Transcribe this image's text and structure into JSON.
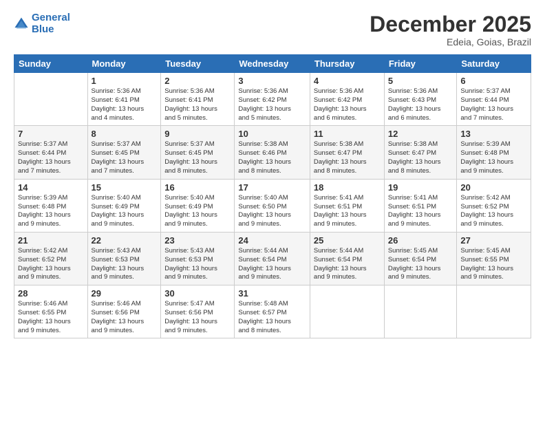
{
  "logo": {
    "line1": "General",
    "line2": "Blue"
  },
  "title": "December 2025",
  "subtitle": "Edeia, Goias, Brazil",
  "days_of_week": [
    "Sunday",
    "Monday",
    "Tuesday",
    "Wednesday",
    "Thursday",
    "Friday",
    "Saturday"
  ],
  "weeks": [
    [
      {
        "day": "",
        "info": ""
      },
      {
        "day": "1",
        "info": "Sunrise: 5:36 AM\nSunset: 6:41 PM\nDaylight: 13 hours\nand 4 minutes."
      },
      {
        "day": "2",
        "info": "Sunrise: 5:36 AM\nSunset: 6:41 PM\nDaylight: 13 hours\nand 5 minutes."
      },
      {
        "day": "3",
        "info": "Sunrise: 5:36 AM\nSunset: 6:42 PM\nDaylight: 13 hours\nand 5 minutes."
      },
      {
        "day": "4",
        "info": "Sunrise: 5:36 AM\nSunset: 6:42 PM\nDaylight: 13 hours\nand 6 minutes."
      },
      {
        "day": "5",
        "info": "Sunrise: 5:36 AM\nSunset: 6:43 PM\nDaylight: 13 hours\nand 6 minutes."
      },
      {
        "day": "6",
        "info": "Sunrise: 5:37 AM\nSunset: 6:44 PM\nDaylight: 13 hours\nand 7 minutes."
      }
    ],
    [
      {
        "day": "7",
        "info": "Sunrise: 5:37 AM\nSunset: 6:44 PM\nDaylight: 13 hours\nand 7 minutes."
      },
      {
        "day": "8",
        "info": "Sunrise: 5:37 AM\nSunset: 6:45 PM\nDaylight: 13 hours\nand 7 minutes."
      },
      {
        "day": "9",
        "info": "Sunrise: 5:37 AM\nSunset: 6:45 PM\nDaylight: 13 hours\nand 8 minutes."
      },
      {
        "day": "10",
        "info": "Sunrise: 5:38 AM\nSunset: 6:46 PM\nDaylight: 13 hours\nand 8 minutes."
      },
      {
        "day": "11",
        "info": "Sunrise: 5:38 AM\nSunset: 6:47 PM\nDaylight: 13 hours\nand 8 minutes."
      },
      {
        "day": "12",
        "info": "Sunrise: 5:38 AM\nSunset: 6:47 PM\nDaylight: 13 hours\nand 8 minutes."
      },
      {
        "day": "13",
        "info": "Sunrise: 5:39 AM\nSunset: 6:48 PM\nDaylight: 13 hours\nand 9 minutes."
      }
    ],
    [
      {
        "day": "14",
        "info": "Sunrise: 5:39 AM\nSunset: 6:48 PM\nDaylight: 13 hours\nand 9 minutes."
      },
      {
        "day": "15",
        "info": "Sunrise: 5:40 AM\nSunset: 6:49 PM\nDaylight: 13 hours\nand 9 minutes."
      },
      {
        "day": "16",
        "info": "Sunrise: 5:40 AM\nSunset: 6:49 PM\nDaylight: 13 hours\nand 9 minutes."
      },
      {
        "day": "17",
        "info": "Sunrise: 5:40 AM\nSunset: 6:50 PM\nDaylight: 13 hours\nand 9 minutes."
      },
      {
        "day": "18",
        "info": "Sunrise: 5:41 AM\nSunset: 6:51 PM\nDaylight: 13 hours\nand 9 minutes."
      },
      {
        "day": "19",
        "info": "Sunrise: 5:41 AM\nSunset: 6:51 PM\nDaylight: 13 hours\nand 9 minutes."
      },
      {
        "day": "20",
        "info": "Sunrise: 5:42 AM\nSunset: 6:52 PM\nDaylight: 13 hours\nand 9 minutes."
      }
    ],
    [
      {
        "day": "21",
        "info": "Sunrise: 5:42 AM\nSunset: 6:52 PM\nDaylight: 13 hours\nand 9 minutes."
      },
      {
        "day": "22",
        "info": "Sunrise: 5:43 AM\nSunset: 6:53 PM\nDaylight: 13 hours\nand 9 minutes."
      },
      {
        "day": "23",
        "info": "Sunrise: 5:43 AM\nSunset: 6:53 PM\nDaylight: 13 hours\nand 9 minutes."
      },
      {
        "day": "24",
        "info": "Sunrise: 5:44 AM\nSunset: 6:54 PM\nDaylight: 13 hours\nand 9 minutes."
      },
      {
        "day": "25",
        "info": "Sunrise: 5:44 AM\nSunset: 6:54 PM\nDaylight: 13 hours\nand 9 minutes."
      },
      {
        "day": "26",
        "info": "Sunrise: 5:45 AM\nSunset: 6:54 PM\nDaylight: 13 hours\nand 9 minutes."
      },
      {
        "day": "27",
        "info": "Sunrise: 5:45 AM\nSunset: 6:55 PM\nDaylight: 13 hours\nand 9 minutes."
      }
    ],
    [
      {
        "day": "28",
        "info": "Sunrise: 5:46 AM\nSunset: 6:55 PM\nDaylight: 13 hours\nand 9 minutes."
      },
      {
        "day": "29",
        "info": "Sunrise: 5:46 AM\nSunset: 6:56 PM\nDaylight: 13 hours\nand 9 minutes."
      },
      {
        "day": "30",
        "info": "Sunrise: 5:47 AM\nSunset: 6:56 PM\nDaylight: 13 hours\nand 9 minutes."
      },
      {
        "day": "31",
        "info": "Sunrise: 5:48 AM\nSunset: 6:57 PM\nDaylight: 13 hours\nand 8 minutes."
      },
      {
        "day": "",
        "info": ""
      },
      {
        "day": "",
        "info": ""
      },
      {
        "day": "",
        "info": ""
      }
    ]
  ]
}
